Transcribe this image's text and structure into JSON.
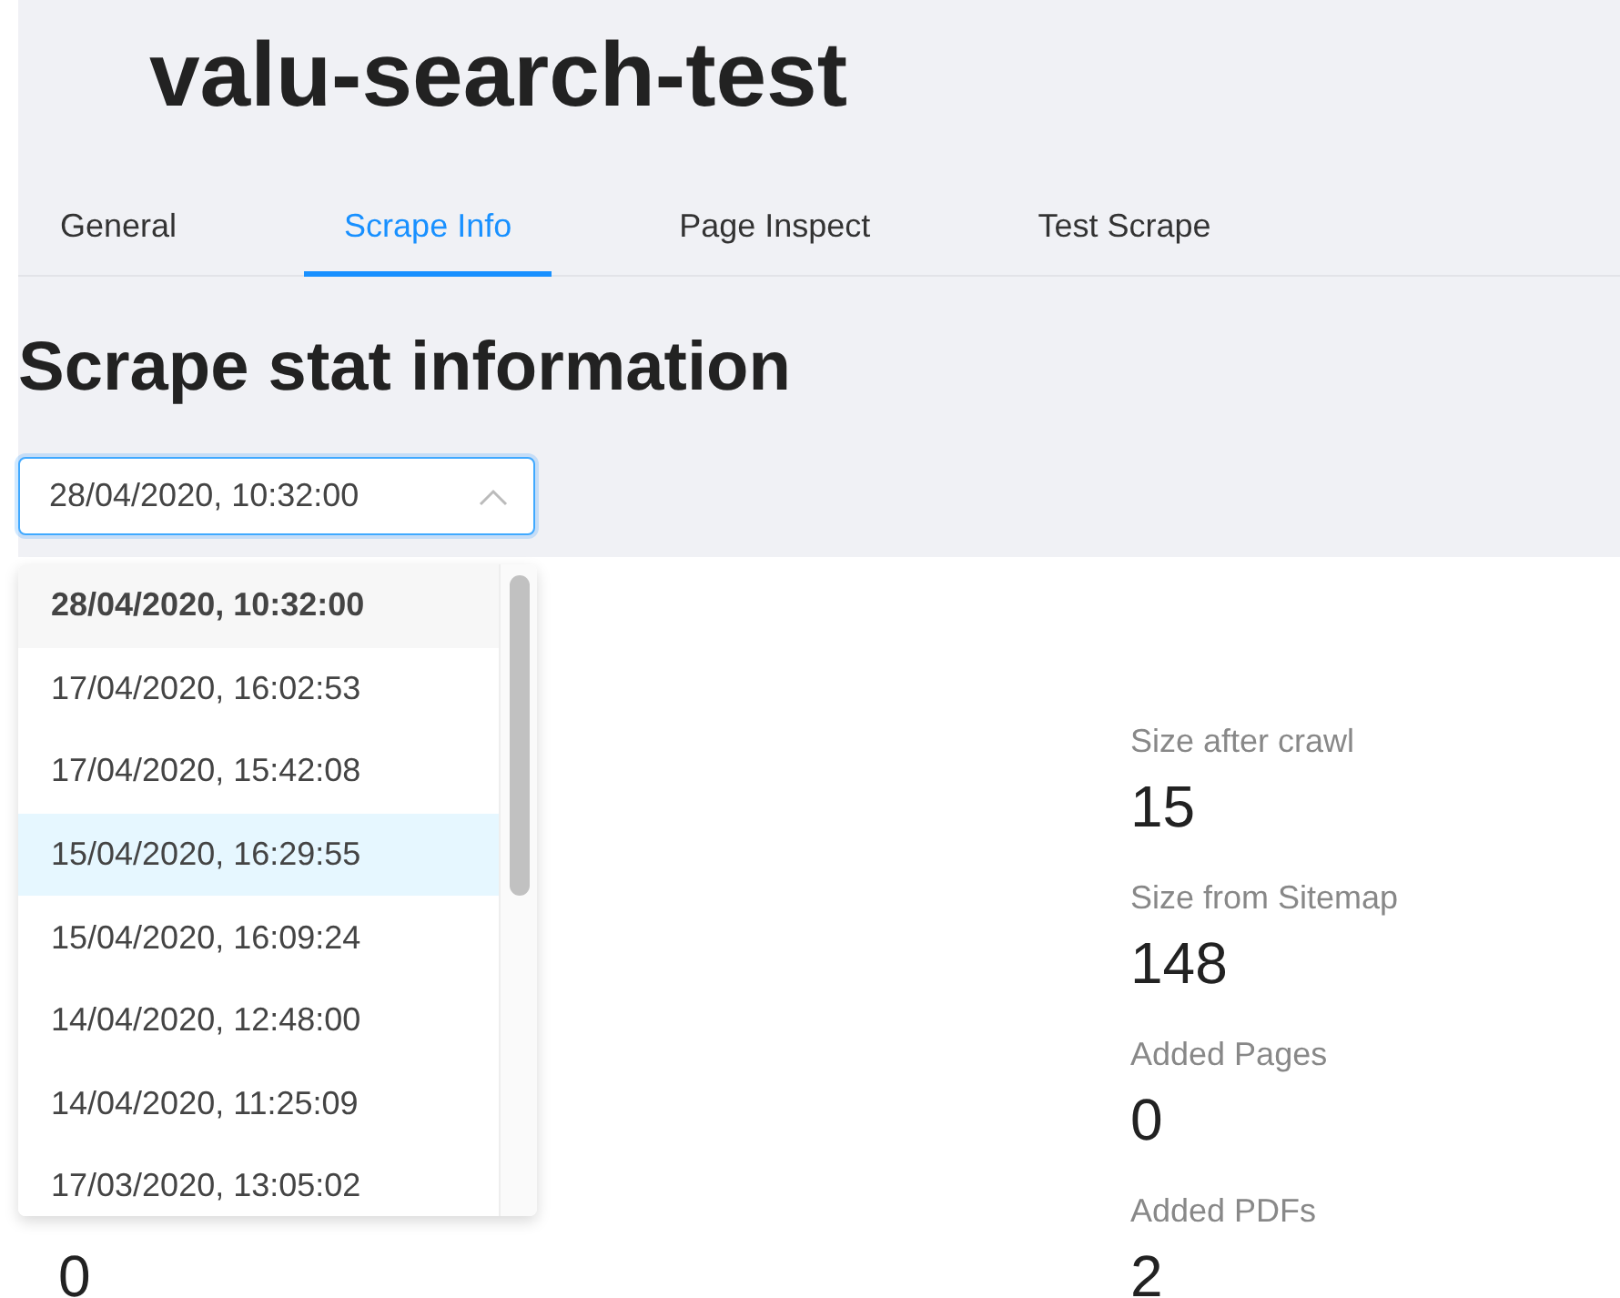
{
  "title": "valu-search-test",
  "tabs": [
    {
      "label": "General",
      "selected": false
    },
    {
      "label": "Scrape Info",
      "selected": true
    },
    {
      "label": "Page Inspect",
      "selected": false
    },
    {
      "label": "Test Scrape",
      "selected": false
    }
  ],
  "heading": "Scrape stat information",
  "date_select": {
    "value": "28/04/2020, 10:32:00",
    "open": true,
    "options": [
      {
        "label": "28/04/2020, 10:32:00",
        "selected": true,
        "hovered": false
      },
      {
        "label": "17/04/2020, 16:02:53",
        "selected": false,
        "hovered": false
      },
      {
        "label": "17/04/2020, 15:42:08",
        "selected": false,
        "hovered": false
      },
      {
        "label": "15/04/2020, 16:29:55",
        "selected": false,
        "hovered": true
      },
      {
        "label": "15/04/2020, 16:09:24",
        "selected": false,
        "hovered": false
      },
      {
        "label": "14/04/2020, 12:48:00",
        "selected": false,
        "hovered": false
      },
      {
        "label": "14/04/2020, 11:25:09",
        "selected": false,
        "hovered": false
      },
      {
        "label": "17/03/2020, 13:05:02",
        "selected": false,
        "hovered": false
      }
    ]
  },
  "left_stat": {
    "value": "0"
  },
  "right_stats": [
    {
      "label": "Size after crawl",
      "value": "15"
    },
    {
      "label": "Size from Sitemap",
      "value": "148"
    },
    {
      "label": "Added Pages",
      "value": "0"
    },
    {
      "label": "Added PDFs",
      "value": "2"
    }
  ]
}
